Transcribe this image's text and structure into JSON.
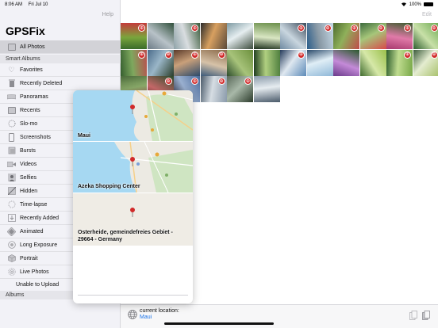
{
  "status": {
    "time": "8:06 AM",
    "date": "Fri Jul 10",
    "battery": "100%"
  },
  "sidebar": {
    "help": "Help",
    "title": "GPSFix",
    "all_photos": "All Photos",
    "smart_albums_header": "Smart Albums",
    "items": [
      {
        "label": "Favorites",
        "icon": "heart-icon"
      },
      {
        "label": "Recently Deleted",
        "icon": "trash-icon"
      },
      {
        "label": "Panoramas",
        "icon": "panorama-icon"
      },
      {
        "label": "Recents",
        "icon": "recents-icon"
      },
      {
        "label": "Slo-mo",
        "icon": "slomo-icon"
      },
      {
        "label": "Screenshots",
        "icon": "phone-icon"
      },
      {
        "label": "Bursts",
        "icon": "burst-icon"
      },
      {
        "label": "Videos",
        "icon": "video-icon"
      },
      {
        "label": "Selfies",
        "icon": "person-icon"
      },
      {
        "label": "Hidden",
        "icon": "hidden-icon"
      },
      {
        "label": "Time-lapse",
        "icon": "timelapse-icon"
      },
      {
        "label": "Recently Added",
        "icon": "download-icon"
      },
      {
        "label": "Animated",
        "icon": "animated-icon"
      },
      {
        "label": "Long Exposure",
        "icon": "long-exposure-icon"
      },
      {
        "label": "Portrait",
        "icon": "cube-icon"
      },
      {
        "label": "Live Photos",
        "icon": "live-photo-icon"
      }
    ],
    "unable_to_upload": "Unable to Upload",
    "albums_header": "Albums"
  },
  "header": {
    "edit": "Edit"
  },
  "popover": {
    "locations": [
      {
        "name": "Maui"
      },
      {
        "name": "Azeka Shopping Center"
      },
      {
        "name": "Osterheide, gemeindefreies Gebiet - 29664 - Germany"
      }
    ]
  },
  "bottom_bar": {
    "label": "current location:",
    "value": "Maui"
  },
  "colors": {
    "accent": "#1a73e8",
    "pin": "#d12a2a",
    "sidebar_bg": "#f2f2f7",
    "selected": "#d2d2d7"
  }
}
